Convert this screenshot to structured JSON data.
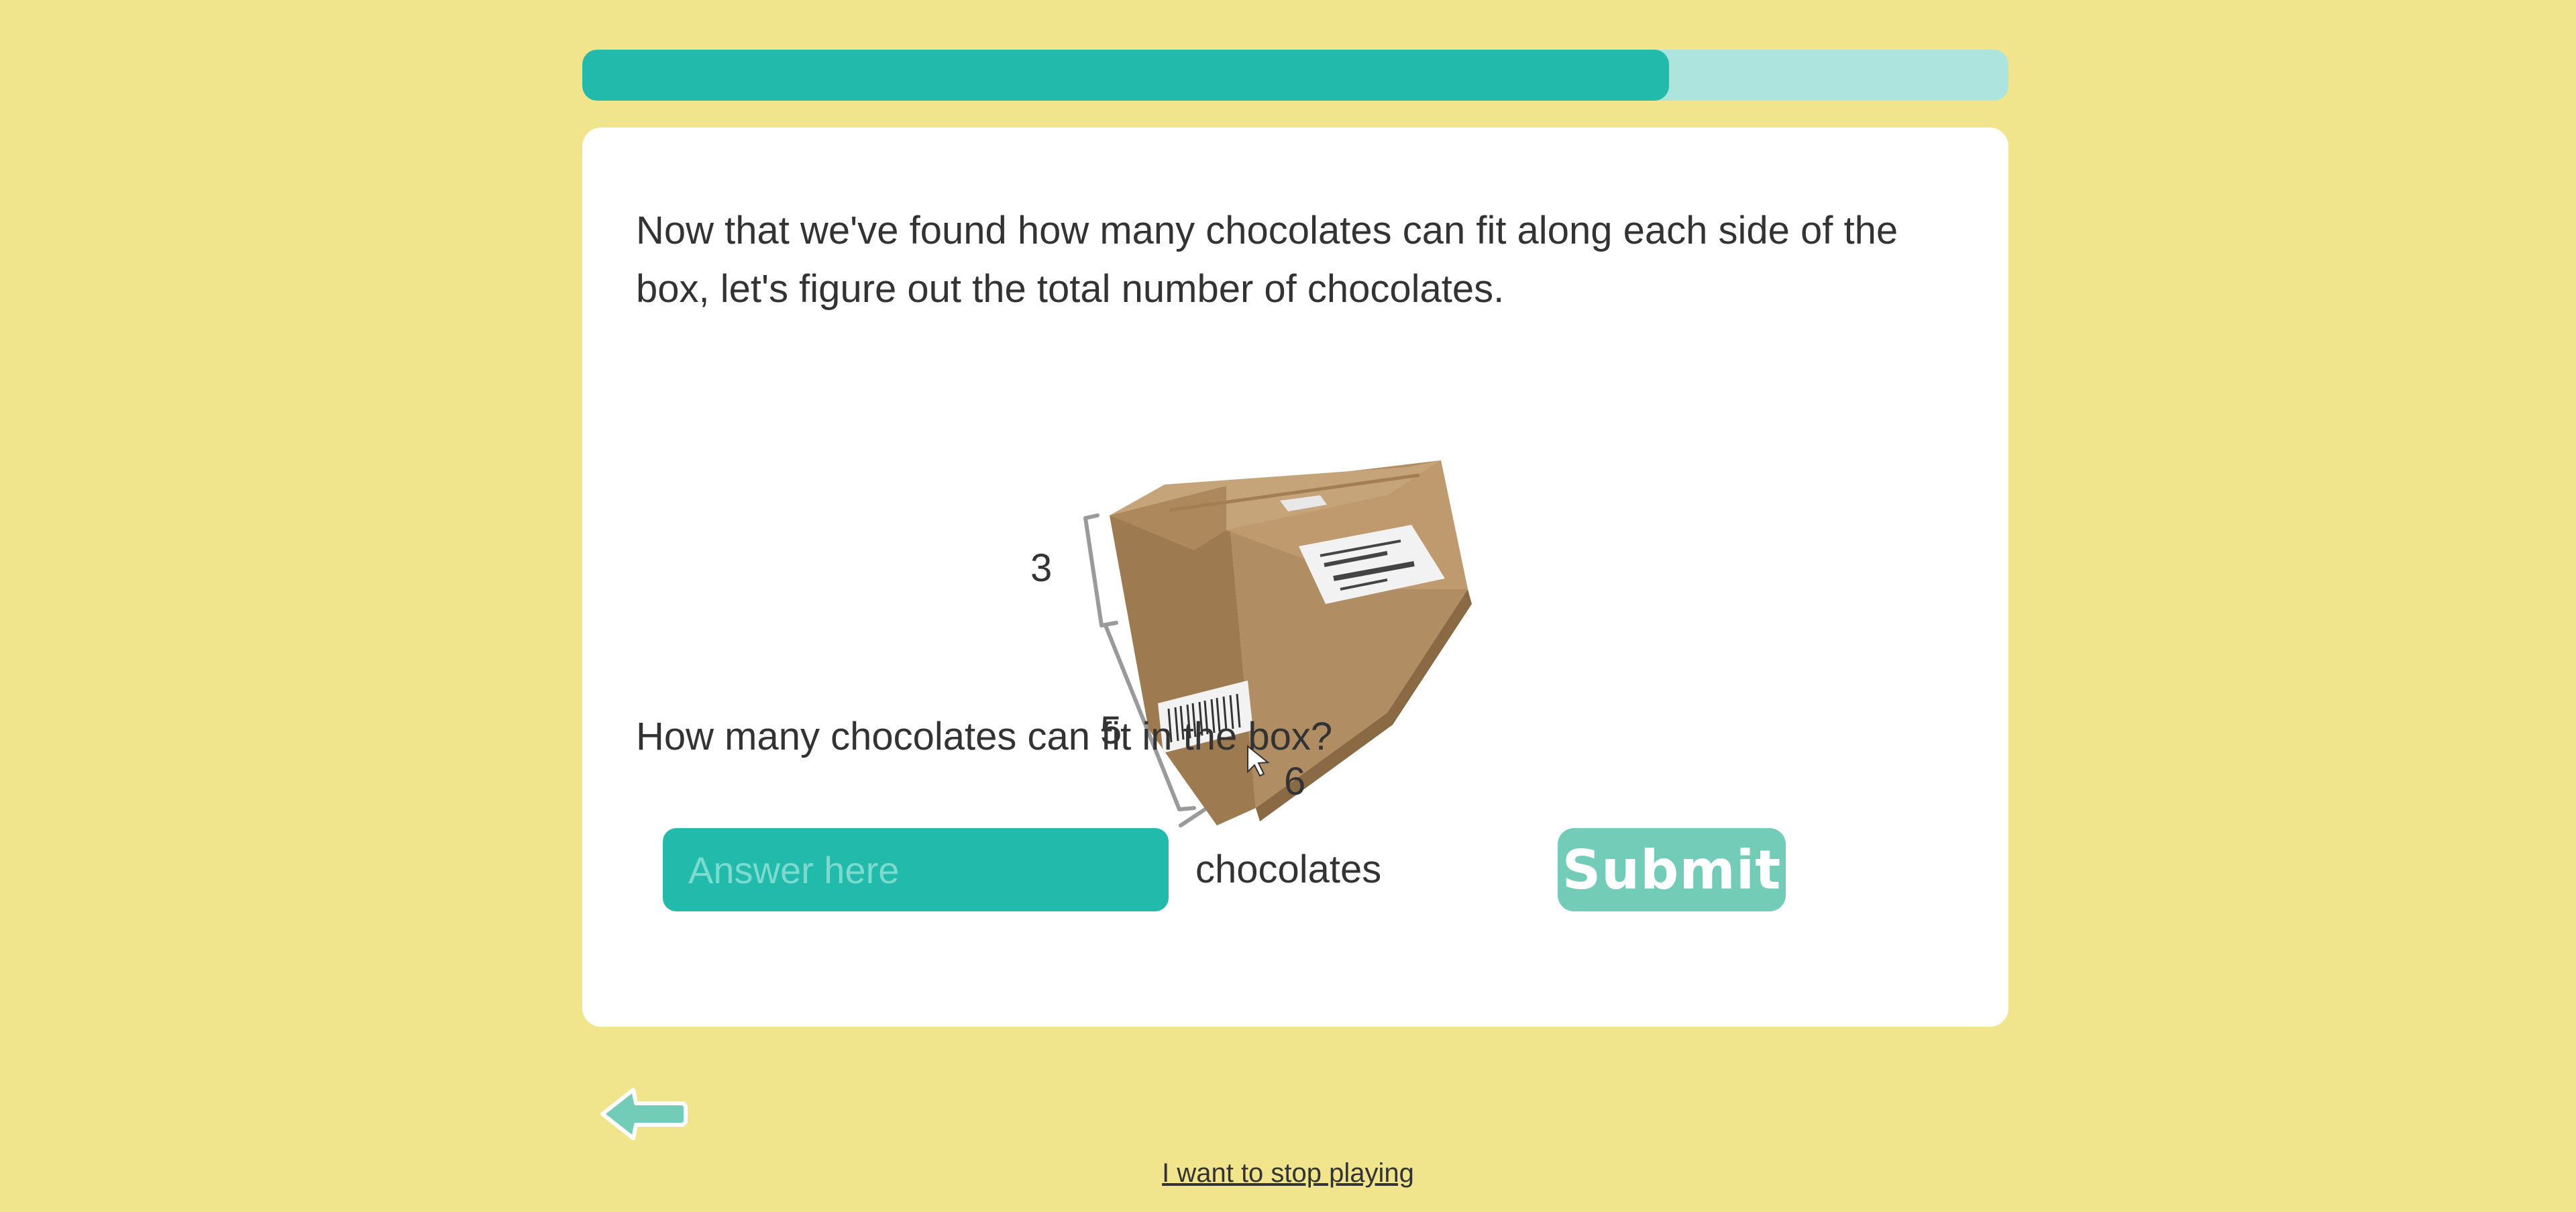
{
  "progress": {
    "fraction": 0.762,
    "fill_color": "#22BAAA",
    "track_color": "#AEE4DE"
  },
  "lesson": {
    "intro": "Now that we've found how many chocolates can fit along each side of the box, let's figure out the total number of chocolates.",
    "figure": {
      "height_label": "3",
      "depth_label": "5",
      "width_label": "6"
    },
    "question": "How many chocolates can fit in the box?"
  },
  "answer": {
    "placeholder": "Answer here",
    "value": "",
    "unit": "chocolates"
  },
  "submit": {
    "label": "Submit"
  },
  "navigation": {
    "back_icon": "arrow-left-icon",
    "stop_link": "I want to stop playing"
  },
  "colors": {
    "background": "#F0E48C",
    "card": "#FFFFFF",
    "accent": "#22BAAA",
    "submit": "#73CCB7"
  }
}
